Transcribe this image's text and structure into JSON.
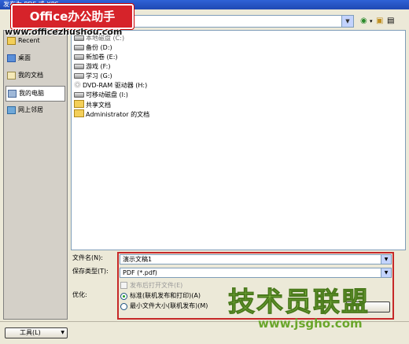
{
  "window": {
    "title": "发布为 PDF 或 XPS"
  },
  "watermark": {
    "logo": "Office办公助手",
    "url": "www.officezhushou.com",
    "brand": "技术员联盟",
    "brand_url": "www.jsgho.com"
  },
  "look_in": {
    "partial_text": "本地磁盘 (C:)"
  },
  "places": [
    {
      "label": "Recent",
      "icon": "recent-folder-icon"
    },
    {
      "label": "桌面",
      "icon": "desktop-icon"
    },
    {
      "label": "我的文档",
      "icon": "documents-icon"
    },
    {
      "label": "我的电脑",
      "icon": "computer-icon"
    },
    {
      "label": "网上邻居",
      "icon": "network-icon"
    }
  ],
  "files": [
    {
      "name": "备份 (D:)",
      "icon": "drive"
    },
    {
      "name": "新加卷 (E:)",
      "icon": "drive"
    },
    {
      "name": "游戏 (F:)",
      "icon": "drive"
    },
    {
      "name": "学习 (G:)",
      "icon": "drive"
    },
    {
      "name": "DVD-RAM 驱动器 (H:)",
      "icon": "cd"
    },
    {
      "name": "可移动磁盘 (I:)",
      "icon": "drive"
    },
    {
      "name": "共享文档",
      "icon": "folder"
    },
    {
      "name": "Administrator 的文档",
      "icon": "folder"
    }
  ],
  "form": {
    "filename_label": "文件名(N):",
    "filename_value": "演示文稿1",
    "filetype_label": "保存类型(T):",
    "filetype_value": "PDF (*.pdf)",
    "open_after_label": "发布后打开文件(E)",
    "optimize_label": "优化:",
    "option_standard": "标准(联机发布和打印)(A)",
    "option_minimum": "最小文件大小(联机发布)(M)"
  },
  "buttons": {
    "tools": "工具(L)"
  }
}
